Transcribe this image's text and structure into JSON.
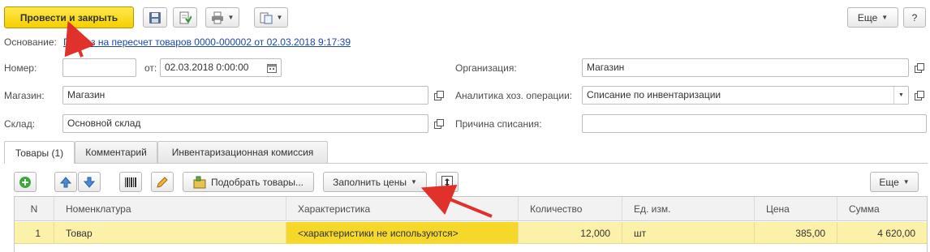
{
  "toolbar": {
    "post_close_label": "Провести и закрыть",
    "more_label": "Еще",
    "help_label": "?"
  },
  "basis": {
    "label": "Основание:",
    "link": "Приказ на пересчет товаров 0000-000002 от 02.03.2018 9:17:39"
  },
  "form": {
    "number_label": "Номер:",
    "number_value": "",
    "from_label": "от:",
    "date_value": "02.03.2018  0:00:00",
    "organization_label": "Организация:",
    "organization_value": "Магазин",
    "store_label": "Магазин:",
    "store_value": "Магазин",
    "analytics_label": "Аналитика хоз. операции:",
    "analytics_value": "Списание по инвентаризации",
    "warehouse_label": "Склад:",
    "warehouse_value": "Основной склад",
    "reason_label": "Причина списания:",
    "reason_value": ""
  },
  "tabs": [
    {
      "label": "Товары (1)"
    },
    {
      "label": "Комментарий"
    },
    {
      "label": "Инвентаризационная комиссия"
    }
  ],
  "table_toolbar": {
    "pick_goods_label": "Подобрать товары...",
    "fill_prices_label": "Заполнить цены",
    "more_label": "Еще"
  },
  "table": {
    "columns": [
      "N",
      "Номенклатура",
      "Характеристика",
      "Количество",
      "Ед. изм.",
      "Цена",
      "Сумма"
    ],
    "rows": [
      {
        "n": "1",
        "item": "Товар",
        "characteristic": "<характеристики не используются>",
        "qty": "12,000",
        "unit": "шт",
        "price": "385,00",
        "sum": "4 620,00"
      }
    ]
  },
  "colors": {
    "primary_button": "#f6cf00",
    "selected_row": "#fbf1a9",
    "selected_cell": "#f5d82a",
    "link": "#1a48a8",
    "annotation_arrow": "#e0322b"
  }
}
